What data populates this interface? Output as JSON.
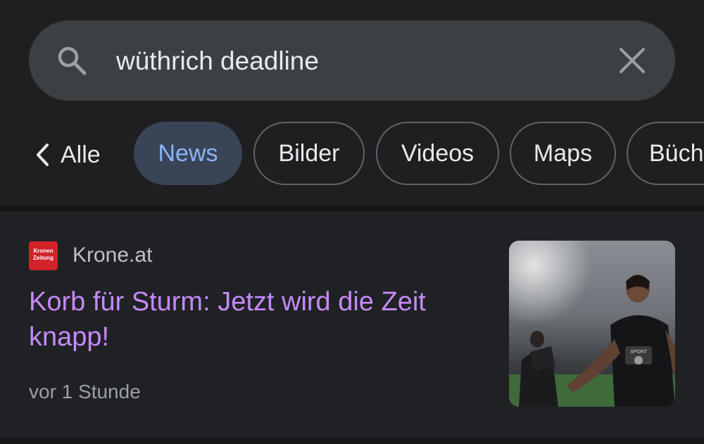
{
  "search": {
    "query": "wüthrich deadline"
  },
  "tabs": {
    "back_label": "Alle",
    "items": [
      {
        "label": "News",
        "active": true
      },
      {
        "label": "Bilder",
        "active": false
      },
      {
        "label": "Videos",
        "active": false
      },
      {
        "label": "Maps",
        "active": false
      },
      {
        "label": "Büch",
        "active": false
      }
    ]
  },
  "result": {
    "favicon_text_line1": "Kronen",
    "favicon_text_line2": "Zeitung",
    "source": "Krone.at",
    "headline": "Korb für Sturm: Jetzt wird die Zeit knapp!",
    "timestamp": "vor 1 Stunde"
  },
  "colors": {
    "background": "#202124",
    "search_bar": "#3c4043",
    "active_chip_bg": "#394457",
    "active_chip_text": "#8ab4f8",
    "visited_link": "#c58af9",
    "favicon_red": "#d2232a"
  },
  "icons": {
    "search": "search-icon",
    "clear": "close-icon",
    "back": "chevron-left-icon"
  }
}
